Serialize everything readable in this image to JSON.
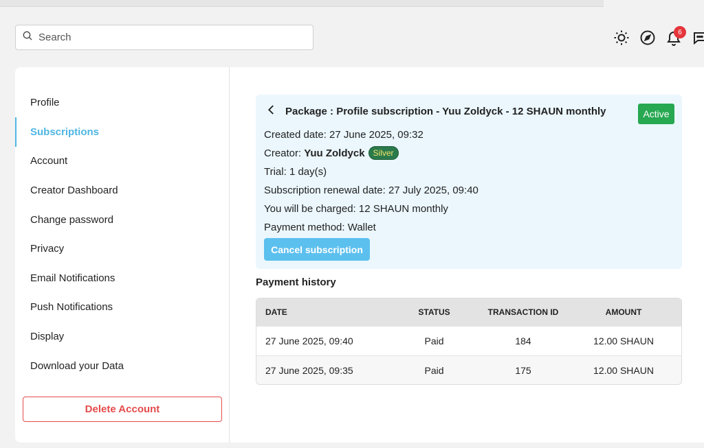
{
  "search": {
    "placeholder": "Search"
  },
  "header": {
    "notification_count": "6"
  },
  "sidebar": {
    "items": [
      {
        "label": "Profile"
      },
      {
        "label": "Subscriptions"
      },
      {
        "label": "Account"
      },
      {
        "label": "Creator Dashboard"
      },
      {
        "label": "Change password"
      },
      {
        "label": "Privacy"
      },
      {
        "label": "Email Notifications"
      },
      {
        "label": "Push Notifications"
      },
      {
        "label": "Display"
      },
      {
        "label": "Download your Data"
      }
    ],
    "active": "Subscriptions",
    "delete_label": "Delete Account"
  },
  "package": {
    "title": "Package : Profile subscription - Yuu Zoldyck - 12 SHAUN monthly",
    "status": "Active",
    "created": "Created date: 27 June 2025, 09:32",
    "creator_label": "Creator:",
    "creator_name": "Yuu Zoldyck",
    "creator_tier": "Silver",
    "trial": "Trial: 1 day(s)",
    "renewal": "Subscription renewal date: 27 July 2025, 09:40",
    "charged": "You will be charged: 12 SHAUN monthly",
    "payment_method": "Payment method: Wallet",
    "cancel_label": "Cancel subscription"
  },
  "history": {
    "title": "Payment history",
    "columns": [
      "DATE",
      "STATUS",
      "TRANSACTION ID",
      "AMOUNT"
    ],
    "rows": [
      [
        "27 June 2025, 09:40",
        "Paid",
        "184",
        "12.00 SHAUN"
      ],
      [
        "27 June 2025, 09:35",
        "Paid",
        "175",
        "12.00 SHAUN"
      ]
    ]
  },
  "colors": {
    "accent": "#4fb6e3",
    "active_badge": "#27a851",
    "danger": "#e44b4b",
    "package_bg": "#ebf7fd"
  }
}
